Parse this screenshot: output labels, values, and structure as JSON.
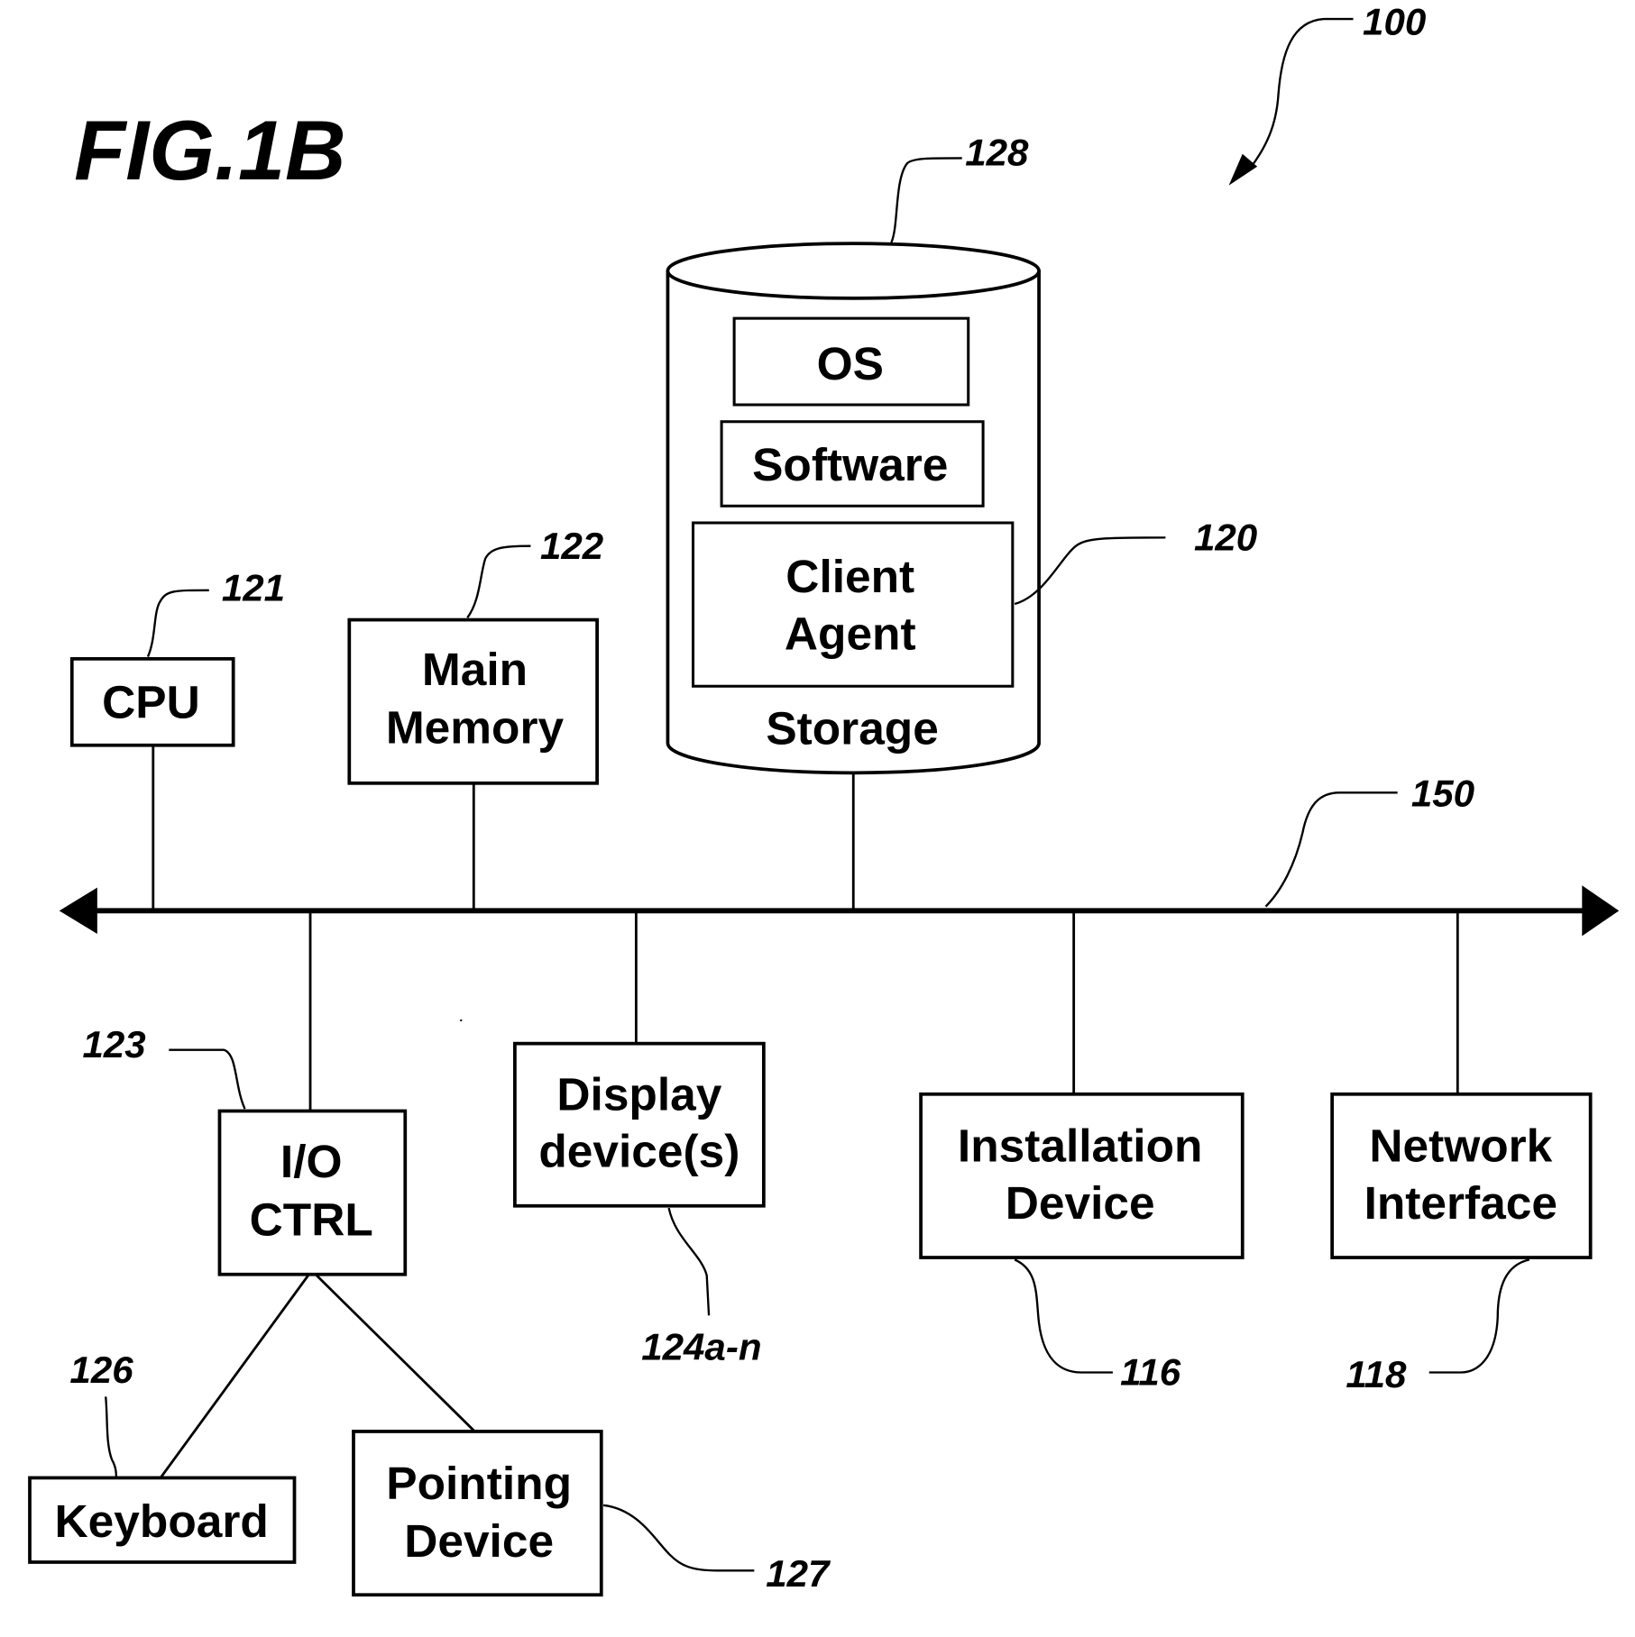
{
  "figure": {
    "title": "FIG.1B",
    "ref": "100"
  },
  "bus": {
    "ref": "150"
  },
  "storage": {
    "label": "Storage",
    "ref": "128",
    "contents": {
      "os": "OS",
      "software": "Software",
      "client_agent": [
        "Client",
        "Agent"
      ]
    },
    "client_agent_ref": "120"
  },
  "components": {
    "cpu": {
      "lines": [
        "CPU"
      ],
      "ref": "121"
    },
    "main_memory": {
      "lines": [
        "Main",
        "Memory"
      ],
      "ref": "122"
    },
    "io_ctrl": {
      "lines": [
        "I/O",
        "CTRL"
      ],
      "ref": "123"
    },
    "display": {
      "lines": [
        "Display",
        "device(s)"
      ],
      "ref": "124a-n"
    },
    "installation": {
      "lines": [
        "Installation",
        "Device"
      ],
      "ref": "116"
    },
    "network": {
      "lines": [
        "Network",
        "Interface"
      ],
      "ref": "118"
    },
    "keyboard": {
      "lines": [
        "Keyboard"
      ],
      "ref": "126"
    },
    "pointing": {
      "lines": [
        "Pointing",
        "Device"
      ],
      "ref": "127"
    }
  }
}
